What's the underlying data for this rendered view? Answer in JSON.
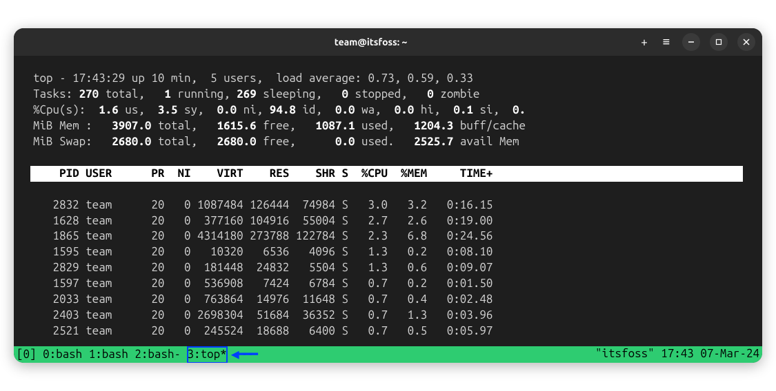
{
  "titlebar": {
    "title": "team@itsfoss: ~"
  },
  "top": {
    "summary": {
      "line1_a": "top - 17:43:29 up 10 min,  5 users,  load average: 0.73, 0.59, 0.33",
      "tasks_label": "Tasks: ",
      "tasks_total": "270 ",
      "tasks_total_lbl": "total,   ",
      "tasks_running": "1 ",
      "tasks_running_lbl": "running, ",
      "tasks_sleeping": "269 ",
      "tasks_sleeping_lbl": "sleeping,   ",
      "tasks_stopped": "0 ",
      "tasks_stopped_lbl": "stopped,   ",
      "tasks_zombie": "0 ",
      "tasks_zombie_lbl": "zombie",
      "cpu_label": "%Cpu(s):  ",
      "cpu_us": "1.6 ",
      "cpu_us_lbl": "us,  ",
      "cpu_sy": "3.5 ",
      "cpu_sy_lbl": "sy,  ",
      "cpu_ni": "0.0 ",
      "cpu_ni_lbl": "ni, ",
      "cpu_id": "94.8 ",
      "cpu_id_lbl": "id,  ",
      "cpu_wa": "0.0 ",
      "cpu_wa_lbl": "wa,  ",
      "cpu_hi": "0.0 ",
      "cpu_hi_lbl": "hi,  ",
      "cpu_si": "0.1 ",
      "cpu_si_lbl": "si,  ",
      "cpu_st": "0.",
      "mem_label": "MiB Mem :   ",
      "mem_total": "3907.0 ",
      "mem_total_lbl": "total,   ",
      "mem_free": "1615.6 ",
      "mem_free_lbl": "free,   ",
      "mem_used": "1087.1 ",
      "mem_used_lbl": "used,   ",
      "mem_buff": "1204.3 ",
      "mem_buff_lbl": "buff/cache",
      "swap_label": "MiB Swap:   ",
      "swap_total": "2680.0 ",
      "swap_total_lbl": "total,   ",
      "swap_free": "2680.0 ",
      "swap_free_lbl": "free,      ",
      "swap_used": "0.0 ",
      "swap_used_lbl": "used.   ",
      "swap_avail": "2525.7 ",
      "swap_avail_lbl": "avail Mem"
    },
    "header": "    PID USER      PR  NI    VIRT    RES    SHR S  %CPU  %MEM     TIME+ ",
    "rows": [
      "   2832 team      20   0 1087484 126444  74984 S   3.0   3.2   0:16.15",
      "   1628 team      20   0  377160 104916  55004 S   2.7   2.6   0:19.00",
      "   1865 team      20   0 4314180 273788 122784 S   2.3   6.8   0:24.56",
      "   1595 team      20   0   10320   6536   4096 S   1.3   0.2   0:08.10",
      "   2829 team      20   0  181448  24832   5504 S   1.3   0.6   0:09.07",
      "   1597 team      20   0  536908   7424   6784 S   0.7   0.2   0:01.50",
      "   2033 team      20   0  763864  14976  11648 S   0.7   0.4   0:02.48",
      "   2403 team      20   0 2698304  51684  36352 S   0.7   1.3   0:03.96",
      "   2521 team      20   0  245524  18688   6400 S   0.7   0.5   0:05.97"
    ]
  },
  "tmux": {
    "left_prefix": "[0] 0:bash  1:bash  2:bash- ",
    "active": "3:top*",
    "right": "\"itsfoss\" 17:43 07-Mar-24"
  }
}
